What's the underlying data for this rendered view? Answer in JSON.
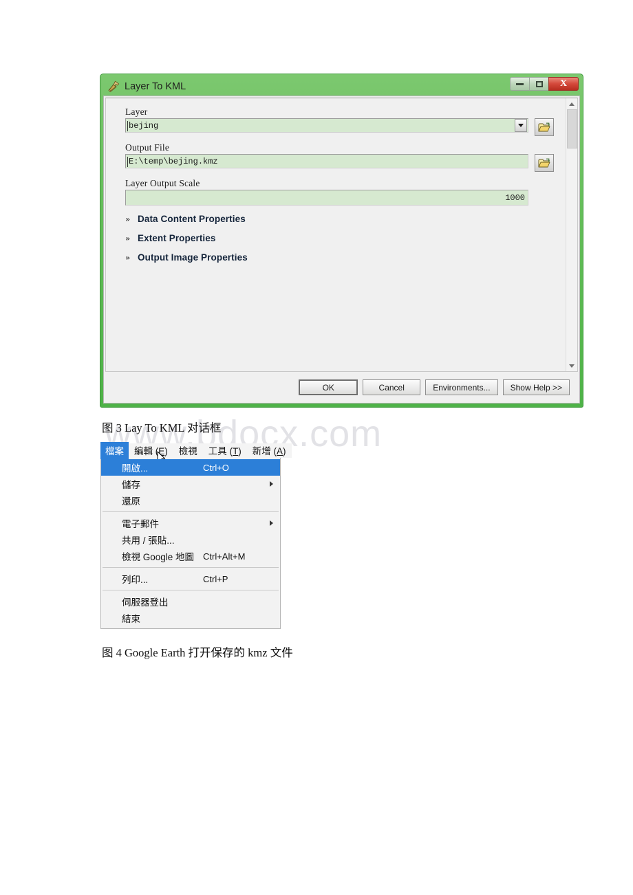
{
  "watermark": {
    "text": "www.bdocx.com"
  },
  "dialog": {
    "title": "Layer To KML",
    "title_icon": "hammer-icon",
    "window_buttons": {
      "minimize": "minimize-icon",
      "maximize": "maximize-icon",
      "close": "X"
    },
    "fields": [
      {
        "label": "Layer",
        "value": "bejing",
        "type": "combobox",
        "browse": "folder-open-icon"
      },
      {
        "label": "Output File",
        "value": "E:\\temp\\bejing.kmz",
        "type": "textbox",
        "browse": "folder-open-icon"
      },
      {
        "label": "Layer Output Scale",
        "value": "1000",
        "type": "numeric"
      }
    ],
    "sections": [
      {
        "chevron": "»",
        "title": "Data Content Properties"
      },
      {
        "chevron": "»",
        "title": "Extent Properties"
      },
      {
        "chevron": "»",
        "title": "Output Image Properties"
      }
    ],
    "buttons": {
      "ok": "OK",
      "cancel": "Cancel",
      "environments": "Environments...",
      "show_help": "Show Help >>"
    }
  },
  "captions": {
    "figure3": "图 3 Lay To KML 对话框",
    "figure4": "图 4 Google Earth 打开保存的 kmz 文件"
  },
  "ge_menu": {
    "menubar": [
      {
        "label": "檔案",
        "accel": "",
        "active": true
      },
      {
        "label": "編輯",
        "accel": "E",
        "active": false
      },
      {
        "label": "檢視",
        "accel": "",
        "active": false
      },
      {
        "label": "工具",
        "accel": "T",
        "active": false
      },
      {
        "label": "新增",
        "accel": "A",
        "active": false
      }
    ],
    "items": [
      {
        "label": "開啟...",
        "shortcut": "Ctrl+O",
        "selected": true,
        "submenu": false,
        "separator_after": false
      },
      {
        "label": "儲存",
        "shortcut": "",
        "selected": false,
        "submenu": true,
        "separator_after": false
      },
      {
        "label": "還原",
        "shortcut": "",
        "selected": false,
        "submenu": false,
        "separator_after": true
      },
      {
        "label": "電子郵件",
        "shortcut": "",
        "selected": false,
        "submenu": true,
        "separator_after": false
      },
      {
        "label": "共用 / 張貼...",
        "shortcut": "",
        "selected": false,
        "submenu": false,
        "separator_after": false
      },
      {
        "label": "檢視 Google 地圖",
        "shortcut": "Ctrl+Alt+M",
        "selected": false,
        "submenu": false,
        "separator_after": true
      },
      {
        "label": "列印...",
        "shortcut": "Ctrl+P",
        "selected": false,
        "submenu": false,
        "separator_after": true
      },
      {
        "label": "伺服器登出",
        "shortcut": "",
        "selected": false,
        "submenu": false,
        "separator_after": false
      },
      {
        "label": "結束",
        "shortcut": "",
        "selected": false,
        "submenu": false,
        "separator_after": false
      }
    ],
    "cursor": "mouse-pointer-icon"
  },
  "colors": {
    "title_green": "#63bd58",
    "input_green": "#d6e9d0",
    "menu_highlight": "#2c7fd8",
    "close_red": "#d4483a",
    "section_title": "#14243a"
  }
}
